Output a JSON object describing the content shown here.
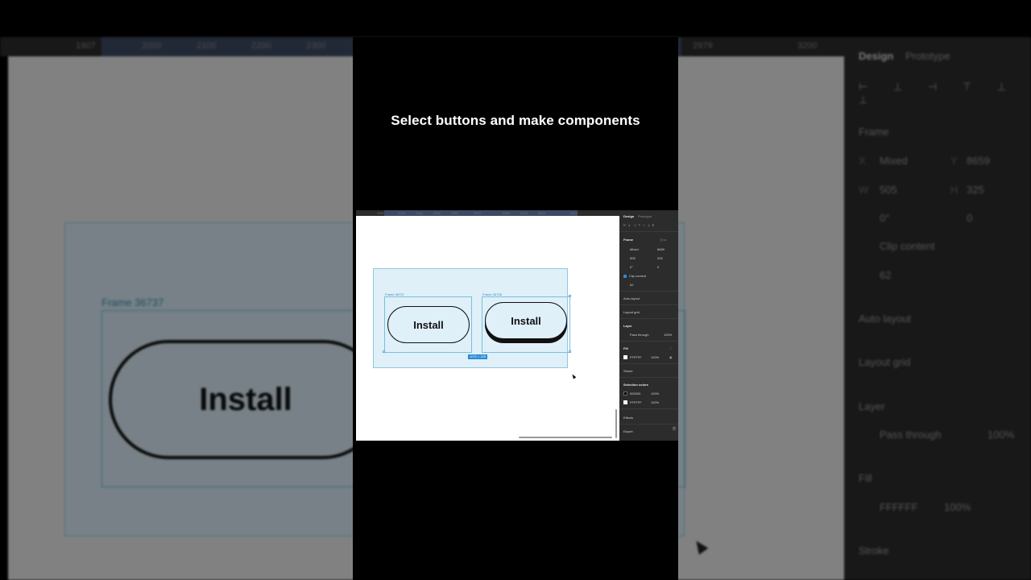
{
  "caption": "Select buttons and make components",
  "bg": {
    "ruler_ticks": [
      "1907",
      "2000",
      "2100",
      "2200",
      "2300",
      "2979",
      "3200"
    ],
    "frame_label": "Frame 36737",
    "button_label": "Install",
    "panel": {
      "tab_design": "Design",
      "tab_prototype": "Prototype",
      "frame": "Frame",
      "x_label": "X",
      "x_value": "Mixed",
      "y_label": "Y",
      "y_value": "8659",
      "w_label": "W",
      "w_value": "505",
      "h_label": "H",
      "h_value": "325",
      "rotation": "0°",
      "radius": "0",
      "clip_content": "Clip content",
      "spacing": "62",
      "auto_layout": "Auto layout",
      "layout_grid": "Layout grid",
      "layer": "Layer",
      "blend": "Pass through",
      "blend_opacity": "100%",
      "fill": "Fill",
      "fill_hex": "FFFFFF",
      "fill_opacity": "100%",
      "stroke": "Stroke"
    }
  },
  "mini": {
    "ruler_ticks": [
      "1907",
      "2000",
      "2100",
      "2200",
      "2300",
      "2979",
      "3000",
      "3100",
      "3200",
      "3300"
    ],
    "frame1_label": "Frame 36737",
    "frame2_label": "Frame 36738",
    "button1_label": "Install",
    "button2_label": "Install",
    "size_badge": "1070 × 225",
    "panel": {
      "tab_design": "Design",
      "tab_prototype": "Prototype",
      "frame": "Frame",
      "x_value": "Mixed",
      "y_value": "8659",
      "w_value": "505",
      "h_value": "325",
      "rotation": "0°",
      "radius": "0",
      "clip_content": "Clip content",
      "spacing": "62",
      "auto_layout": "Auto layout",
      "layout_grid": "Layout grid",
      "layer": "Layer",
      "blend": "Pass through",
      "blend_opacity": "100%",
      "fill": "Fill",
      "fill_hex": "FFFFFF",
      "fill_opacity": "100%",
      "stroke": "Stroke",
      "selection_colors": "Selection colors",
      "sel1_hex": "000000",
      "sel1_opacity": "100%",
      "sel2_hex": "FFFFFF",
      "sel2_opacity": "100%",
      "effects": "Effects",
      "export": "Export",
      "help": "?"
    }
  },
  "colors": {
    "selection_blue": "#2b8ad8",
    "frame_fill": "#dff0f9",
    "panel_bg": "#2c2c2c"
  }
}
